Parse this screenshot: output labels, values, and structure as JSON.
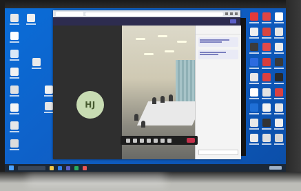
{
  "window": {
    "title": ""
  },
  "participant": {
    "initials": "HJ",
    "name": ""
  },
  "chat": {
    "header": "",
    "input_placeholder": ""
  },
  "controls": {
    "timer": ""
  },
  "colors": {
    "desktop": "#0f5fc6",
    "teams_title": "#2d2c4f",
    "avatar": "#c8dcb3",
    "leave": "#c4314b"
  }
}
